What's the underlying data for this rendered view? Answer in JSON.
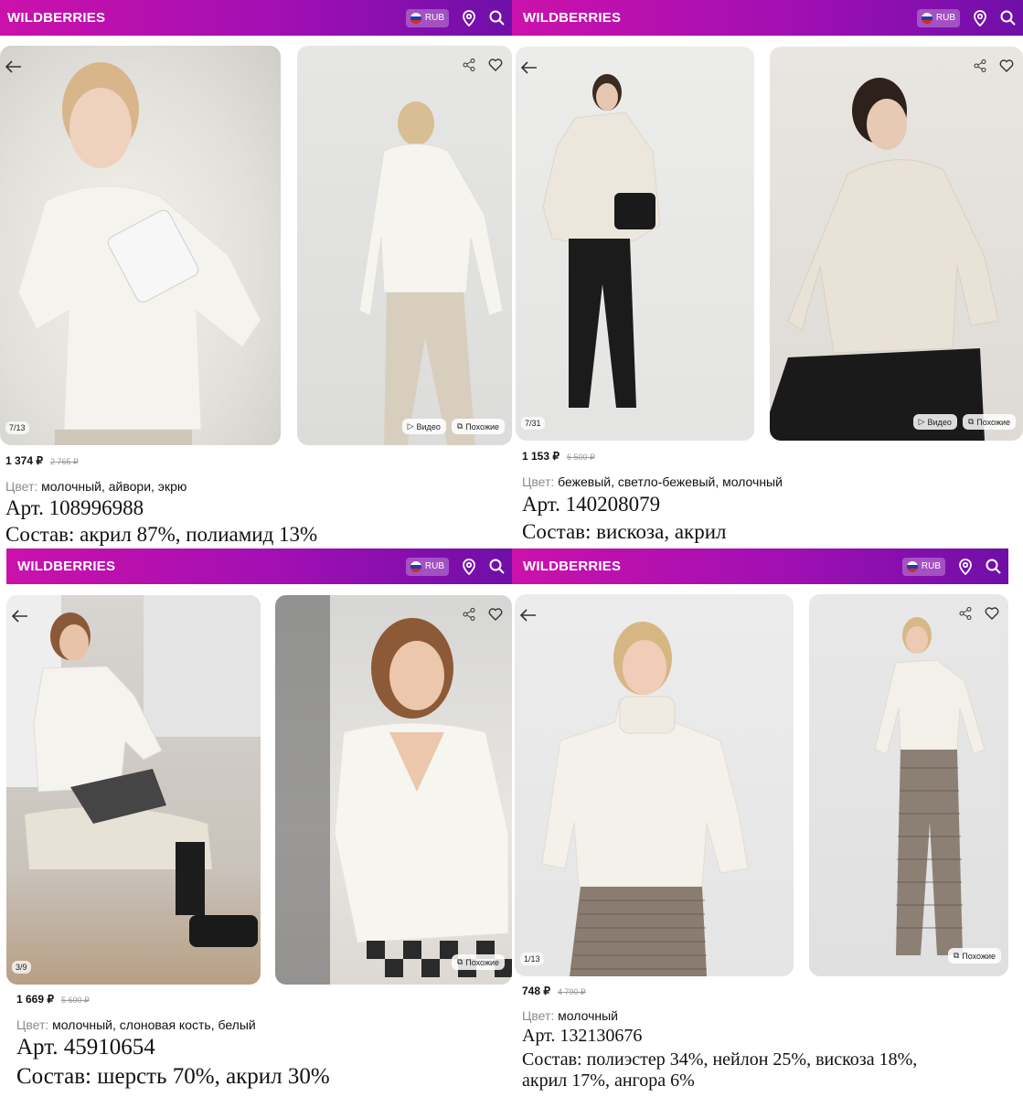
{
  "brand": {
    "logo_text": "WILDBERRIES",
    "currency": "RUB",
    "accent": "#a10fb3"
  },
  "panels": [
    {
      "counter": "7/13",
      "chips": {
        "video": "Видео",
        "similar": "Похожие"
      },
      "price": "1 374 ₽",
      "old_price": "2 765 ₽",
      "color_label": "Цвет:",
      "color_value": "молочный, айвори, экрю",
      "article": "Арт. 108996988",
      "composition": "Состав: акрил 87%, полиамид 13%"
    },
    {
      "counter": "7/31",
      "chips": {
        "video": "Видео",
        "similar": "Похожие"
      },
      "price": "1 153 ₽",
      "old_price": "6 500 ₽",
      "color_label": "Цвет:",
      "color_value": "бежевый, светло-бежевый, молочный",
      "article": "Арт. 140208079",
      "composition": "Состав: вискоза, акрил"
    },
    {
      "counter": "3/9",
      "chips": {
        "similar": "Похожие"
      },
      "price": "1 669 ₽",
      "old_price": "5 600 ₽",
      "color_label": "Цвет:",
      "color_value": "молочный, слоновая кость, белый",
      "article": "Арт. 45910654",
      "composition": "Состав: шерсть 70%, акрил 30%"
    },
    {
      "counter": "1/13",
      "chips": {
        "similar": "Похожие"
      },
      "price": "748 ₽",
      "old_price": "4 790 ₽",
      "color_label": "Цвет:",
      "color_value": "молочный",
      "article": "Арт. 132130676",
      "composition": "Состав: полиэстер 34%, нейлон 25%, вискоза 18%, акрил 17%, ангора 6%"
    }
  ]
}
